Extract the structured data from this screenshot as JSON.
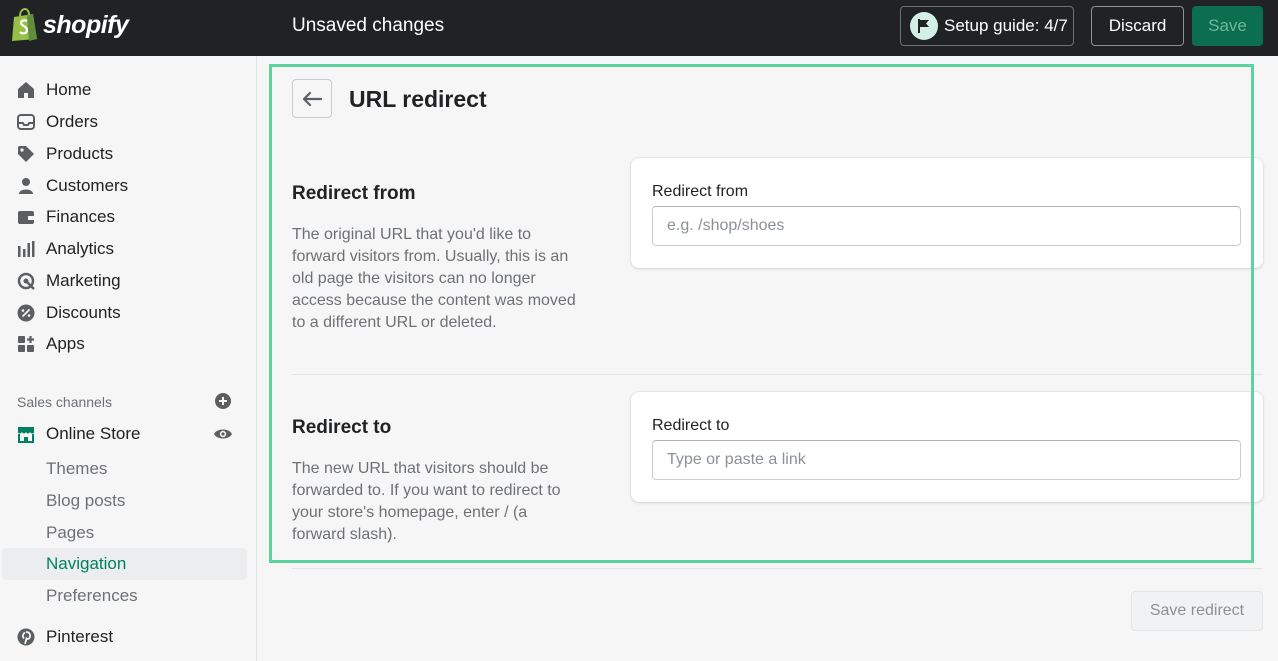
{
  "topbar": {
    "brand": "shopify",
    "title": "Unsaved changes",
    "setup_guide": "Setup guide: 4/7",
    "discard": "Discard",
    "save": "Save"
  },
  "sidebar": {
    "items": [
      {
        "label": "Home",
        "icon": "home-icon"
      },
      {
        "label": "Orders",
        "icon": "orders-icon"
      },
      {
        "label": "Products",
        "icon": "tag-icon"
      },
      {
        "label": "Customers",
        "icon": "person-icon"
      },
      {
        "label": "Finances",
        "icon": "wallet-icon"
      },
      {
        "label": "Analytics",
        "icon": "bar-chart-icon"
      },
      {
        "label": "Marketing",
        "icon": "target-icon"
      },
      {
        "label": "Discounts",
        "icon": "discount-icon"
      },
      {
        "label": "Apps",
        "icon": "apps-icon"
      }
    ],
    "sales_channels_label": "Sales channels",
    "online_store": "Online Store",
    "sub_items": [
      "Themes",
      "Blog posts",
      "Pages",
      "Navigation",
      "Preferences"
    ],
    "active_sub_item": "Navigation",
    "pinterest": "Pinterest"
  },
  "main": {
    "title": "URL redirect",
    "redirect_from": {
      "heading": "Redirect from",
      "description": "The original URL that you'd like to forward visitors from. Usually, this is an old page the visitors can no longer access because the content was moved to a different URL or deleted.",
      "field_label": "Redirect from",
      "placeholder": "e.g. /shop/shoes",
      "value": ""
    },
    "redirect_to": {
      "heading": "Redirect to",
      "description": "The new URL that visitors should be forwarded to. If you want to redirect to your store's homepage, enter / (a forward slash).",
      "field_label": "Redirect to",
      "placeholder": "Type or paste a link",
      "value": ""
    },
    "save_redirect": "Save redirect"
  },
  "colors": {
    "topbar": "#202223",
    "accent_green": "#008060",
    "highlight": "#5dd39e"
  }
}
